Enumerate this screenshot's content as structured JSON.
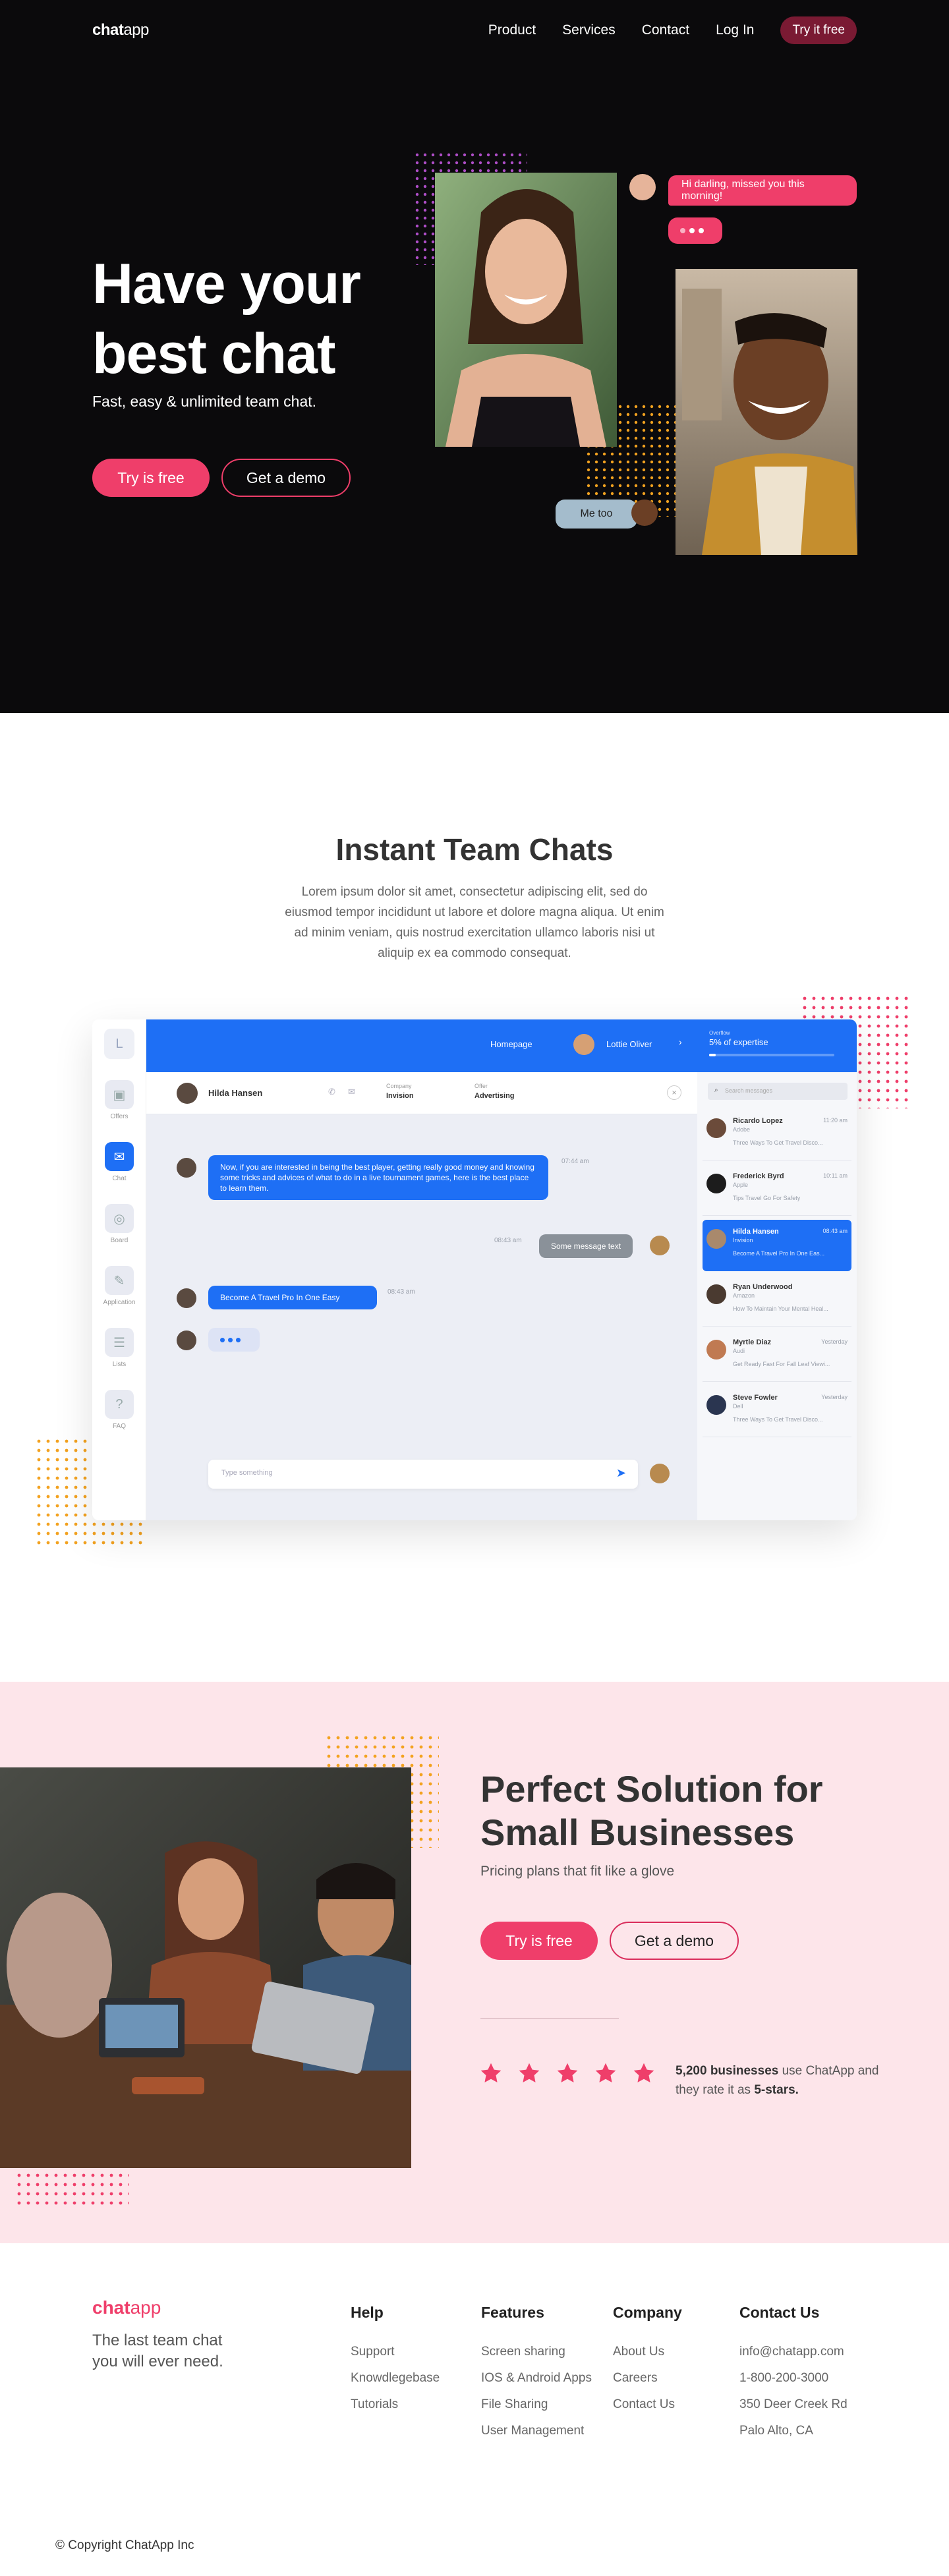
{
  "nav": {
    "logo_bold": "chat",
    "logo_light": "app",
    "links": [
      "Product",
      "Services",
      "Contact",
      "Log In"
    ],
    "cta": "Try it free"
  },
  "hero": {
    "title_line1": "Have your",
    "title_line2": "best chat",
    "subtitle": "Fast, easy & unlimited team chat.",
    "btn_primary": "Try is free",
    "btn_secondary": "Get a demo",
    "bubble_top": "Hi darling, missed you this morning!",
    "bubble_reply": "Me too"
  },
  "section2": {
    "title": "Instant Team Chats",
    "text": "Lorem ipsum dolor sit amet, consectetur adipiscing elit, sed do eiusmod tempor incididunt ut labore et dolore magna aliqua. Ut enim ad minim veniam, quis nostrud exercitation ullamco laboris nisi ut aliquip ex ea commodo consequat."
  },
  "app": {
    "logo_letter": "L",
    "sidebar": [
      "Offers",
      "Chat",
      "Board",
      "Application",
      "Lists",
      "FAQ"
    ],
    "top_link": "Homepage",
    "top_user": "Lottie Oliver",
    "expertise_label": "Overflow",
    "expertise_value": "5% of expertise",
    "expertise_progress": 0.05,
    "contact_name": "Hilda Hansen",
    "company_label": "Company",
    "company_value": "Invision",
    "offer_label": "Offer",
    "offer_value": "Advertising",
    "messages": [
      {
        "text": "Now, if you are interested in being the best player, getting really good money and knowing some tricks and advices of what to do in a live tournament games, here is the best place to learn them.",
        "time": "07:44 am"
      },
      {
        "text": "Some message text",
        "time": "08:43 am"
      },
      {
        "text": "Become A Travel Pro In One Easy",
        "time": "08:43 am"
      }
    ],
    "input_placeholder": "Type something",
    "search_placeholder": "Search messages",
    "contacts": [
      {
        "name": "Ricardo Lopez",
        "company": "Adobe",
        "time": "11:20 am",
        "preview": "Three Ways To Get Travel Disco..."
      },
      {
        "name": "Frederick Byrd",
        "company": "Apple",
        "time": "10:11 am",
        "preview": "Tips Travel Go For Safety"
      },
      {
        "name": "Hilda Hansen",
        "company": "Invision",
        "time": "08:43 am",
        "preview": "Become A Travel Pro In One Eas..."
      },
      {
        "name": "Ryan Underwood",
        "company": "Amazon",
        "time": "",
        "preview": "How To Maintain Your Mental Heal..."
      },
      {
        "name": "Myrtle Diaz",
        "company": "Audi",
        "time": "Yesterday",
        "preview": "Get Ready Fast For Fall Leaf Viewi..."
      },
      {
        "name": "Steve Fowler",
        "company": "Dell",
        "time": "Yesterday",
        "preview": "Three Ways To Get Travel Disco..."
      }
    ]
  },
  "section3": {
    "title_line1": "Perfect Solution for",
    "title_line2": "Small Businesses",
    "subtitle": "Pricing plans that fit like a glove",
    "btn_primary": "Try is free",
    "btn_secondary": "Get a demo",
    "rating_count": "5,200 businesses",
    "rating_mid": " use ChatApp and they rate it as ",
    "rating_value": "5-stars.",
    "stars": 5
  },
  "footer": {
    "logo_bold": "chat",
    "logo_light": "app",
    "tagline": "The last team chat you will ever need.",
    "cols": [
      {
        "title": "Help",
        "items": [
          "Support",
          "Knowdlegebase",
          "Tutorials"
        ]
      },
      {
        "title": "Features",
        "items": [
          "Screen sharing",
          "IOS & Android Apps",
          "File Sharing",
          "User Management"
        ]
      },
      {
        "title": "Company",
        "items": [
          "About Us",
          "Careers",
          "Contact Us"
        ]
      },
      {
        "title": "Contact Us",
        "items": [
          "info@chatapp.com",
          "1-800-200-3000",
          "350 Deer Creek Rd",
          "Palo Alto, CA"
        ]
      }
    ],
    "copyright": "© Copyright ChatApp Inc"
  },
  "colors": {
    "accent": "#ef3e6a",
    "blue": "#1e6ff5",
    "dark": "#0b0a0c",
    "pink_bg": "#fde5ea"
  }
}
